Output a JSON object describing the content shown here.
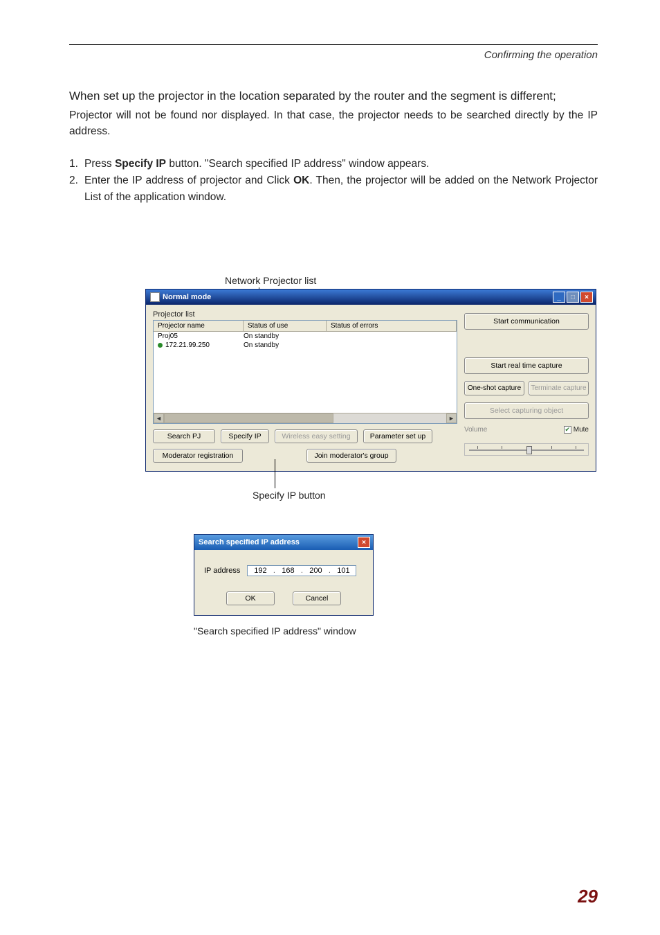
{
  "header": {
    "section": "Confirming the operation"
  },
  "lead": "When set up the projector in the location separated by the router and the segment is different;",
  "para1": "Projector will not be found nor displayed. In that case, the projector needs to be searched directly by the IP address.",
  "steps": {
    "s1_num": "1.",
    "s1_a": "Press ",
    "s1_bold": "Specify IP",
    "s1_b": " button.  \"Search specified IP address\" window appears.",
    "s2_num": "2.",
    "s2_a": "Enter the IP address of projector and Click ",
    "s2_bold": "OK",
    "s2_b": ".  Then, the projector will be added on the Network Projector List of the application window."
  },
  "labels": {
    "network_pj_list": "Network Projector list",
    "specify_ip_btn": "Specify IP button",
    "search_window_caption": "\"Search specified IP address\" window"
  },
  "mainwin": {
    "title": "Normal mode",
    "group_title": "Projector list",
    "cols": {
      "name": "Projector name",
      "use": "Status of use",
      "err": "Status of errors"
    },
    "rows": [
      {
        "name": "Proj05",
        "use": "On standby",
        "err": ""
      },
      {
        "name": "172.21.99.250",
        "use": "On standby",
        "err": ""
      }
    ],
    "btns": {
      "search_pj": "Search PJ",
      "specify_ip": "Specify IP",
      "wireless_easy": "Wireless easy setting",
      "param_setup": "Parameter set up",
      "mod_reg": "Moderator registration",
      "join_mod": "Join moderator's group"
    },
    "right": {
      "start_comm": "Start communication",
      "start_rt": "Start real time capture",
      "oneshot": "One-shot capture",
      "terminate": "Terminate capture",
      "select_obj": "Select capturing object",
      "volume": "Volume",
      "mute": "Mute"
    }
  },
  "dlg": {
    "title": "Search specified IP address",
    "label": "IP address",
    "ip": [
      "192",
      "168",
      "200",
      "101"
    ],
    "ok": "OK",
    "cancel": "Cancel"
  },
  "page_number": "29"
}
